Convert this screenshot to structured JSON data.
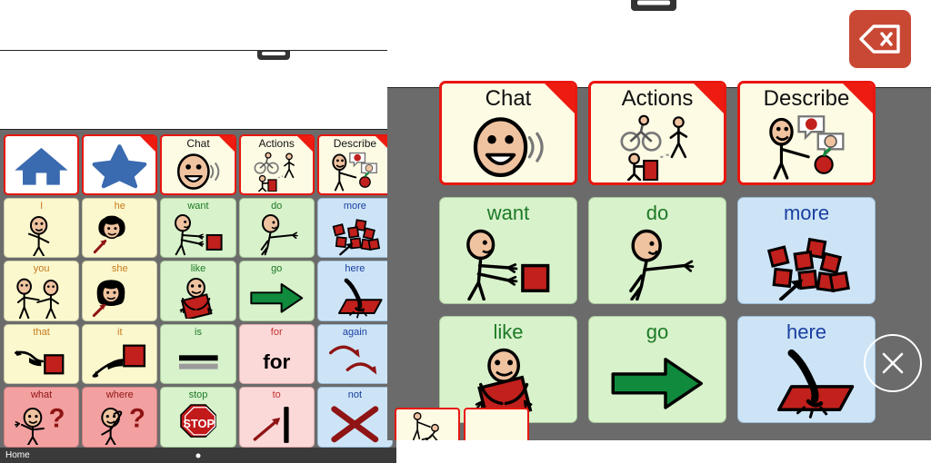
{
  "app": {
    "footer_label": "Home",
    "page_dot": "●"
  },
  "base_window": {
    "message_bar_text": "",
    "grip_icon": "drag-handle"
  },
  "overlay": {
    "message_bar_text": "",
    "backspace_icon": "backspace-delete-icon",
    "close_icon": "close-x-icon",
    "grip_icon": "drag-handle"
  },
  "base_grid": {
    "rows": [
      [
        {
          "label": "",
          "icon": "home-icon",
          "style": "nav",
          "fold": false
        },
        {
          "label": "",
          "icon": "star-icon",
          "style": "nav",
          "fold": true
        },
        {
          "label": "Chat",
          "icon": "talking-face-icon",
          "style": "cat",
          "fold": true
        },
        {
          "label": "Actions",
          "icon": "actions-icon",
          "style": "cat",
          "fold": true
        },
        {
          "label": "Describe",
          "icon": "describe-icon",
          "style": "cat",
          "fold": true
        }
      ],
      [
        {
          "label": "I",
          "icon": "person-pointing-self-icon",
          "style": "yellow",
          "fold": false
        },
        {
          "label": "he",
          "icon": "boy-face-arrow-icon",
          "style": "yellow",
          "fold": false
        },
        {
          "label": "want",
          "icon": "person-reaching-square-icon",
          "style": "green",
          "fold": false
        },
        {
          "label": "do",
          "icon": "person-reaching-icon",
          "style": "green",
          "fold": false
        },
        {
          "label": "more",
          "icon": "many-squares-arrow-icon",
          "style": "blue",
          "fold": false
        }
      ],
      [
        {
          "label": "you",
          "icon": "two-people-pointing-icon",
          "style": "yellow",
          "fold": false
        },
        {
          "label": "she",
          "icon": "girl-face-arrow-icon",
          "style": "yellow",
          "fold": false
        },
        {
          "label": "like",
          "icon": "person-hugging-square-icon",
          "style": "green",
          "fold": false
        },
        {
          "label": "go",
          "icon": "green-arrow-right-icon",
          "style": "green",
          "fold": false
        },
        {
          "label": "here",
          "icon": "hand-pointing-surface-icon",
          "style": "blue",
          "fold": false
        }
      ],
      [
        {
          "label": "that",
          "icon": "hand-pointing-away-square-icon",
          "style": "yellow",
          "fold": false
        },
        {
          "label": "it",
          "icon": "hand-pointing-square-icon",
          "style": "yellow",
          "fold": false
        },
        {
          "label": "is",
          "icon": "equals-bars-icon",
          "style": "green",
          "fold": false
        },
        {
          "label": "for",
          "icon": "word-for-icon",
          "style": "pink",
          "fold": false
        },
        {
          "label": "again",
          "icon": "two-curved-arrows-icon",
          "style": "blue",
          "fold": false
        }
      ],
      [
        {
          "label": "what",
          "icon": "person-question-icon",
          "style": "red",
          "fold": false
        },
        {
          "label": "where",
          "icon": "person-looking-question-icon",
          "style": "red",
          "fold": false
        },
        {
          "label": "stop",
          "icon": "stop-sign-icon",
          "style": "green",
          "fold": false
        },
        {
          "label": "to",
          "icon": "arrow-to-bar-icon",
          "style": "pink",
          "fold": false
        },
        {
          "label": "not",
          "icon": "red-x-icon",
          "style": "blue",
          "fold": false
        }
      ]
    ],
    "word_for_text": "for",
    "stop_sign_text": "STOP"
  },
  "overlay_grid": {
    "rows": [
      [
        {
          "label": "Chat",
          "icon": "talking-face-icon",
          "style": "cat",
          "fold": true
        },
        {
          "label": "Actions",
          "icon": "actions-icon",
          "style": "cat",
          "fold": true
        },
        {
          "label": "Describe",
          "icon": "describe-icon",
          "style": "cat",
          "fold": true
        }
      ],
      [
        {
          "label": "want",
          "icon": "person-reaching-square-icon",
          "style": "green",
          "fold": false
        },
        {
          "label": "do",
          "icon": "person-reaching-icon",
          "style": "green",
          "fold": false
        },
        {
          "label": "more",
          "icon": "many-squares-arrow-icon",
          "style": "blue",
          "fold": false
        }
      ],
      [
        {
          "label": "like",
          "icon": "person-hugging-square-icon",
          "style": "green",
          "fold": false
        },
        {
          "label": "go",
          "icon": "green-arrow-right-icon",
          "style": "green",
          "fold": false
        },
        {
          "label": "here",
          "icon": "hand-pointing-surface-icon",
          "style": "blue",
          "fold": false
        }
      ]
    ],
    "bottom_tiles": [
      {
        "label": "",
        "icon": "help-person-icon"
      },
      {
        "label": "",
        "icon": "blank-icon"
      }
    ]
  },
  "colors": {
    "accent_red": "#e8170f",
    "backspace_red": "#c94834",
    "board_background": "#6b6b6b",
    "footer_background": "#3a3a3a",
    "yellow_tile": "#fbf8cd",
    "green_tile": "#d8f2cb",
    "blue_tile": "#cde4f7",
    "pink_tile": "#fcd9d9",
    "red_tile": "#f3a0a0",
    "category_tile": "#fdfbe4"
  }
}
